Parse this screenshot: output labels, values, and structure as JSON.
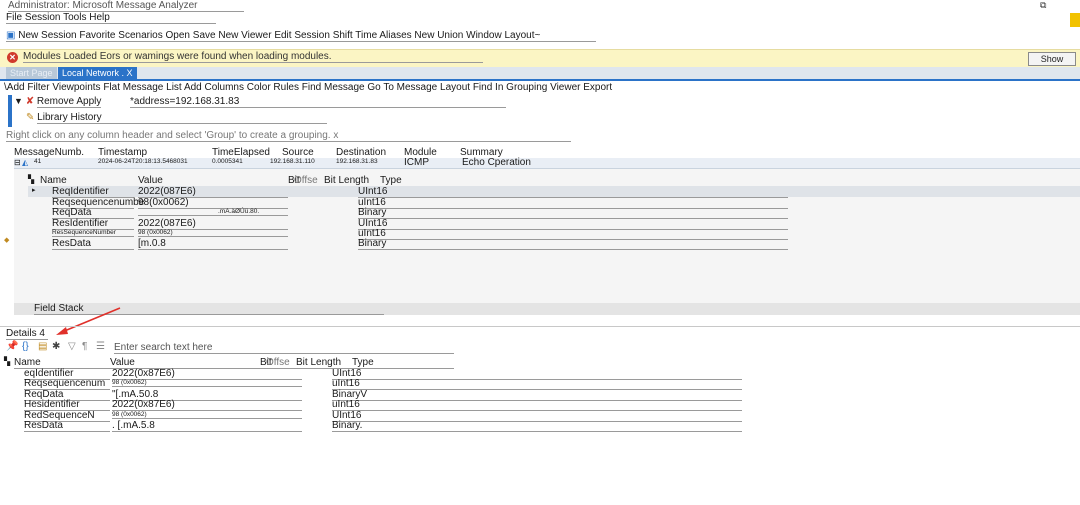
{
  "window": {
    "title": "Administrator: Microsoft Message Analyzer",
    "restore_glyph": "⧉",
    "close_glyph": "✕"
  },
  "menu": [
    "File",
    "Session",
    "Tools",
    "Help"
  ],
  "toolbar": {
    "items": [
      "New Session",
      "Favorite Scenarios",
      "Open",
      "Save",
      "New Viewer",
      "Edit Session",
      "Shift Time",
      "Aliases",
      "New Union",
      "Window Layout~"
    ]
  },
  "banner": {
    "message": "Modules Loaded Eors or wamings were found when loading modules.",
    "button": "Show"
  },
  "tabs": {
    "start": "Start Page",
    "active": "Local Network . X"
  },
  "analysis_toolbar": {
    "items": [
      "Add Filter",
      "Viewpoints",
      "Flat Message List",
      "Add Columns",
      "Color Rules",
      "Find Message",
      "Go To Message",
      "Layout",
      "Find In Grouping Viewer",
      "Export"
    ]
  },
  "filter": {
    "apply": "Remove Apply",
    "expression": "*address=192.168.31.83",
    "history": "Library History"
  },
  "group_hint": "Right click on any column header and select 'Group' to create a grouping. x",
  "grid": {
    "headers": [
      "MessageNumb.",
      "Timestamp",
      "TimeElapsed",
      "Source",
      "Destination",
      "Module",
      "Summary"
    ],
    "row": {
      "number": "41",
      "timestamp": "2024-06-24T20:18:13.5468031",
      "elapsed": "0.0005341",
      "source": "192.168.31.110",
      "destination": "192.168.31.83",
      "module": "ICMP",
      "summary": "Echo Cperation"
    }
  },
  "nested": {
    "headers": [
      "Name",
      "Value",
      "Bit",
      "Offse",
      "Bit Length",
      "Type"
    ],
    "rows": [
      {
        "name": "ReqIdentifier",
        "value": "2022(087E6)",
        "type": "UInt16"
      },
      {
        "name": "Reqsequencenumbe",
        "value": "98(0x0062)",
        "type": "uInt16"
      },
      {
        "name": "ReqData",
        "value": ".mA.àØÚü.80.",
        "type": "Binary"
      },
      {
        "name": "ResIdentifier",
        "value": "2022(087E6)",
        "type": "UInt16"
      },
      {
        "name": "ResSequenceNumber",
        "value": "98 (0x0062)",
        "type": "uInt16"
      },
      {
        "name": "ResData",
        "value": "[m.0.8",
        "type": "Binary"
      }
    ]
  },
  "field_stack": "Field Stack",
  "details": {
    "title": "Details 4",
    "search_placeholder": "Enter search text here",
    "headers": [
      "Name",
      "Value",
      "Bit",
      "Offse",
      "Bit Length",
      "Type"
    ],
    "rows": [
      {
        "name": "eqIdentifier",
        "value": "2022(0x87E6)",
        "type": "UInt16"
      },
      {
        "name": "Reqsequencenum",
        "value": "98 (0x0062)",
        "type": "uInt16"
      },
      {
        "name": "ReqData",
        "value": "\"[.mA.50.8",
        "type": "BinaryV"
      },
      {
        "name": "Hesidentifier",
        "value": "2022(0x87E6)",
        "type": "uInt16"
      },
      {
        "name": "RedSequenceN",
        "value": "98 (0x0062)",
        "type": "UInt16"
      },
      {
        "name": "ResData",
        "value": ". [.mA.5.8",
        "type": "Binary."
      }
    ]
  },
  "colors": {
    "accent": "#2b73c8",
    "banner_bg": "#fbf5c4",
    "error": "#d03a2c",
    "annotation": "#e0302a"
  }
}
